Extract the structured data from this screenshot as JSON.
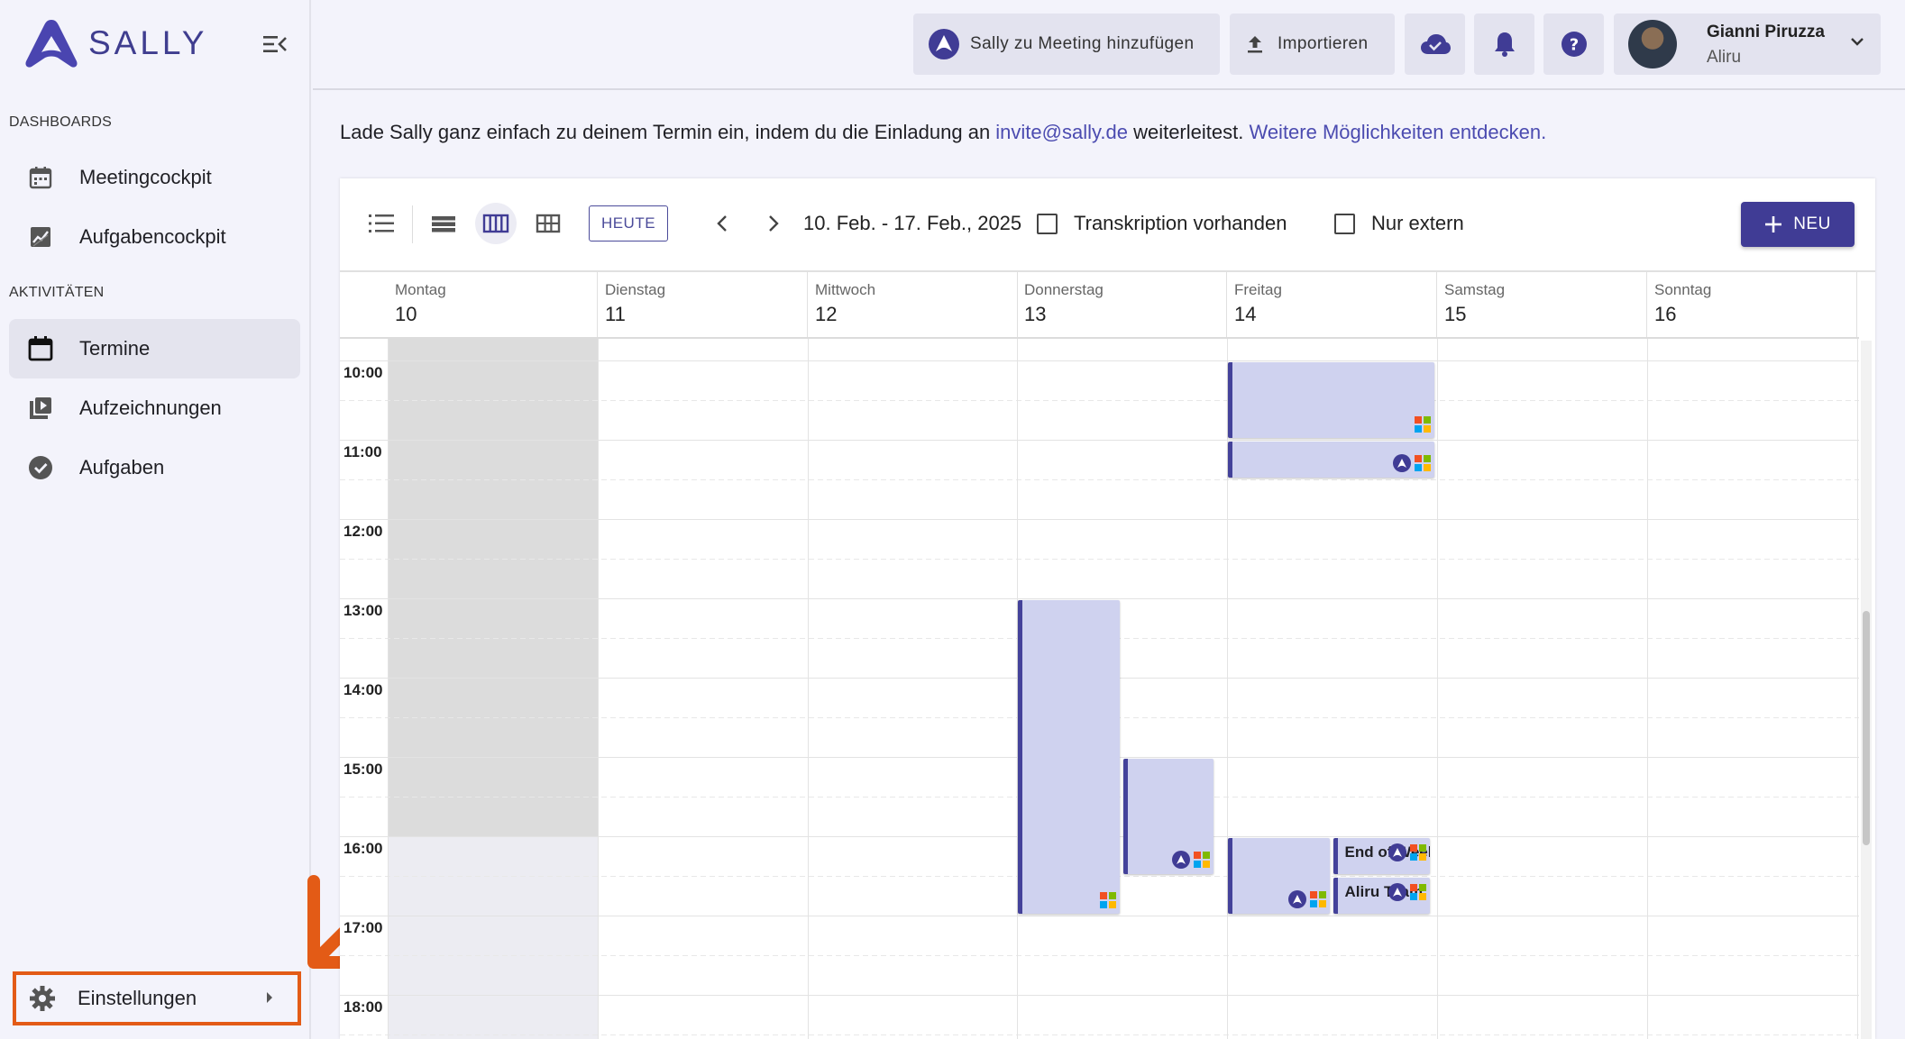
{
  "app": {
    "name": "SALLY"
  },
  "sidebar": {
    "sections": [
      {
        "title": "DASHBOARDS",
        "items": [
          {
            "label": "Meetingcockpit",
            "icon": "calendar-dashboard-icon"
          },
          {
            "label": "Aufgabencockpit",
            "icon": "chart-icon"
          }
        ]
      },
      {
        "title": "AKTIVITÄTEN",
        "items": [
          {
            "label": "Termine",
            "icon": "calendar-icon",
            "active": true
          },
          {
            "label": "Aufzeichnungen",
            "icon": "video-library-icon"
          },
          {
            "label": "Aufgaben",
            "icon": "check-circle-icon"
          }
        ]
      }
    ],
    "settings_label": "Einstellungen"
  },
  "topbar": {
    "add_meeting_label": "Sally zu Meeting hinzufügen",
    "import_label": "Importieren",
    "user_name": "Gianni Piruzza",
    "user_org": "Aliru"
  },
  "info": {
    "text_before": "Lade Sally ganz einfach zu deinem Termin ein, indem du die Einladung an ",
    "email": "invite@sally.de",
    "text_middle": " weiterleitest. ",
    "link": "Weitere Möglichkeiten entdecken."
  },
  "toolbar": {
    "today_label": "HEUTE",
    "date_range": "10. Feb. - 17. Feb., 2025",
    "filter_transcription": "Transkription vorhanden",
    "filter_external": "Nur extern",
    "new_label": "NEU"
  },
  "calendar": {
    "days": [
      {
        "name": "Montag",
        "num": "10"
      },
      {
        "name": "Dienstag",
        "num": "11"
      },
      {
        "name": "Mittwoch",
        "num": "12"
      },
      {
        "name": "Donnerstag",
        "num": "13"
      },
      {
        "name": "Freitag",
        "num": "14"
      },
      {
        "name": "Samstag",
        "num": "15"
      },
      {
        "name": "Sonntag",
        "num": "16"
      }
    ],
    "hours": [
      "10:00",
      "11:00",
      "12:00",
      "13:00",
      "14:00",
      "15:00",
      "16:00",
      "17:00",
      "18:00"
    ],
    "events": [
      {
        "day": "Freitag",
        "start": "10:00",
        "end": "11:00",
        "title": ""
      },
      {
        "day": "Freitag",
        "start": "11:00",
        "end": "11:30",
        "title": ""
      },
      {
        "day": "Donnerstag",
        "start": "13:00",
        "end": "17:00",
        "title": ""
      },
      {
        "day": "Donnerstag",
        "start": "15:00",
        "end": "16:30",
        "title": ""
      },
      {
        "day": "Freitag",
        "start": "16:00",
        "end": "17:00",
        "title": ""
      },
      {
        "day": "Freitag",
        "start": "16:00",
        "end": "16:30",
        "title": "End of Week"
      },
      {
        "day": "Freitag",
        "start": "16:30",
        "end": "17:00",
        "title": "Aliru Team"
      }
    ]
  },
  "colors": {
    "brand": "#403c95",
    "event_bg": "#cfd2ef",
    "highlight": "#e35b16",
    "link": "#4b4bb0"
  }
}
